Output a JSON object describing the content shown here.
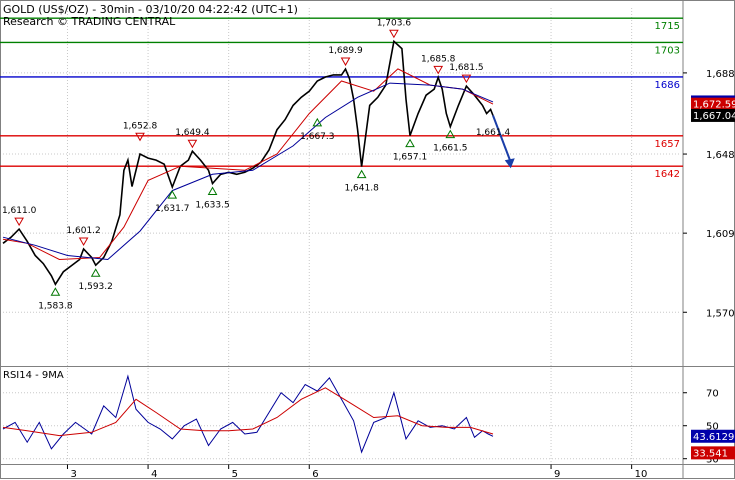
{
  "header": {
    "title": "GOLD (US$/OZ) - 30min - 03/10/20 04:22:42 (UTC+1)",
    "research": "Research © TRADING CENTRAL"
  },
  "colors": {
    "background": "#ffffff",
    "grid": "#c8c8c8",
    "price": "#000000",
    "ma_fast": "#cc0000",
    "ma_slow": "#000099",
    "resistance": "#008000",
    "pivot": "#0000cc",
    "support": "#dd0000",
    "arrow": "#1a3ea8",
    "rsi": "#000099",
    "rsi_ma": "#cc0000",
    "tag_price": "#000000",
    "tag_fast": "#cc0000",
    "tag_slow": "#0000aa"
  },
  "chart_data": [
    {
      "type": "line",
      "name": "price",
      "ylim": [
        1544,
        1720
      ],
      "y_ticks": [
        1570,
        1609,
        1648,
        1688
      ],
      "y_tick_labels": [
        "1,570",
        "1,609",
        "1,648",
        "1,688"
      ],
      "x_tick_labels": [
        "3",
        "4",
        "5",
        "6",
        "9",
        "10"
      ],
      "x_ticks": [
        3,
        4,
        5,
        6,
        9,
        10
      ],
      "xlim": [
        2.2,
        10.6
      ],
      "grid": true,
      "series": [
        {
          "values": [
            [
              2.2,
              1604
            ],
            [
              2.3,
              1607
            ],
            [
              2.4,
              1611
            ],
            [
              2.5,
              1605
            ],
            [
              2.6,
              1598
            ],
            [
              2.7,
              1594
            ],
            [
              2.8,
              1588
            ],
            [
              2.85,
              1583.8
            ],
            [
              2.95,
              1590
            ],
            [
              3.05,
              1593
            ],
            [
              3.15,
              1596
            ],
            [
              3.2,
              1601.2
            ],
            [
              3.3,
              1597
            ],
            [
              3.35,
              1593.2
            ],
            [
              3.45,
              1597
            ],
            [
              3.55,
              1605
            ],
            [
              3.65,
              1618
            ],
            [
              3.7,
              1640
            ],
            [
              3.75,
              1645
            ],
            [
              3.8,
              1632
            ],
            [
              3.9,
              1648
            ],
            [
              4.0,
              1646
            ],
            [
              4.1,
              1645
            ],
            [
              4.2,
              1643
            ],
            [
              4.3,
              1631.7
            ],
            [
              4.4,
              1642
            ],
            [
              4.5,
              1645
            ],
            [
              4.55,
              1649.4
            ],
            [
              4.65,
              1645
            ],
            [
              4.75,
              1640
            ],
            [
              4.8,
              1633.5
            ],
            [
              4.9,
              1638
            ],
            [
              5.0,
              1639
            ],
            [
              5.1,
              1638
            ],
            [
              5.2,
              1639
            ],
            [
              5.3,
              1641
            ],
            [
              5.4,
              1644
            ],
            [
              5.5,
              1650
            ],
            [
              5.6,
              1660
            ],
            [
              5.7,
              1665
            ],
            [
              5.8,
              1672
            ],
            [
              5.9,
              1676
            ],
            [
              6.0,
              1679
            ],
            [
              6.1,
              1684
            ],
            [
              6.2,
              1686
            ],
            [
              6.3,
              1687
            ],
            [
              6.4,
              1687
            ],
            [
              6.45,
              1689.9
            ],
            [
              6.5,
              1685
            ],
            [
              6.55,
              1675
            ],
            [
              6.6,
              1660
            ],
            [
              6.65,
              1641.8
            ],
            [
              6.75,
              1672
            ],
            [
              6.85,
              1676
            ],
            [
              6.95,
              1682
            ],
            [
              7.0,
              1693
            ],
            [
              7.05,
              1703.6
            ],
            [
              7.15,
              1700
            ],
            [
              7.2,
              1675
            ],
            [
              7.25,
              1657.1
            ],
            [
              7.35,
              1668
            ],
            [
              7.45,
              1677
            ],
            [
              7.55,
              1680
            ],
            [
              7.6,
              1685.8
            ],
            [
              7.65,
              1680
            ],
            [
              7.7,
              1668
            ],
            [
              7.75,
              1661.5
            ],
            [
              7.85,
              1672
            ],
            [
              7.95,
              1681.5
            ],
            [
              8.05,
              1677
            ],
            [
              8.15,
              1672
            ],
            [
              8.2,
              1668
            ],
            [
              8.25,
              1670
            ],
            [
              8.28,
              1667
            ]
          ]
        },
        {
          "values": [
            [
              2.2,
              1606
            ],
            [
              2.5,
              1604
            ],
            [
              2.9,
              1596
            ],
            [
              3.4,
              1597
            ],
            [
              3.7,
              1612
            ],
            [
              4.0,
              1635
            ],
            [
              4.4,
              1642
            ],
            [
              4.8,
              1641
            ],
            [
              5.2,
              1640
            ],
            [
              5.6,
              1648
            ],
            [
              6.0,
              1668
            ],
            [
              6.4,
              1684
            ],
            [
              6.8,
              1679
            ],
            [
              7.1,
              1690
            ],
            [
              7.5,
              1682
            ],
            [
              7.9,
              1680
            ],
            [
              8.28,
              1672.6
            ]
          ]
        },
        {
          "values": [
            [
              2.2,
              1607
            ],
            [
              2.6,
              1603
            ],
            [
              3.0,
              1598
            ],
            [
              3.5,
              1596
            ],
            [
              3.9,
              1610
            ],
            [
              4.3,
              1630
            ],
            [
              4.8,
              1638
            ],
            [
              5.3,
              1640
            ],
            [
              5.8,
              1652
            ],
            [
              6.2,
              1666
            ],
            [
              6.6,
              1676
            ],
            [
              7.0,
              1683
            ],
            [
              7.5,
              1682
            ],
            [
              7.9,
              1680
            ],
            [
              8.28,
              1673.7
            ]
          ]
        }
      ],
      "levels": [
        {
          "value": 1715,
          "label": "1715",
          "kind": "resistance"
        },
        {
          "value": 1703,
          "label": "1703",
          "kind": "resistance"
        },
        {
          "value": 1686,
          "label": "1686",
          "kind": "pivot"
        },
        {
          "value": 1657,
          "label": "1657",
          "kind": "support"
        },
        {
          "value": 1642,
          "label": "1642",
          "kind": "support"
        }
      ],
      "tags": [
        {
          "value": 1673.68,
          "label": "1,673.68",
          "kind": "slow"
        },
        {
          "value": 1672.59,
          "label": "1,672.59",
          "kind": "fast"
        },
        {
          "value": 1667.04,
          "label": "1,667.04",
          "kind": "price"
        }
      ],
      "annotations": [
        {
          "x": 2.4,
          "y": 1611.0,
          "label": "1,611.0",
          "mark": "down"
        },
        {
          "x": 2.85,
          "y": 1583.8,
          "label": "1,583.8",
          "mark": "up"
        },
        {
          "x": 3.2,
          "y": 1601.2,
          "label": "1,601.2",
          "mark": "down"
        },
        {
          "x": 3.35,
          "y": 1593.2,
          "label": "1,593.2",
          "mark": "up"
        },
        {
          "x": 3.9,
          "y": 1652.8,
          "label": "1,652.8",
          "mark": "down"
        },
        {
          "x": 4.3,
          "y": 1631.7,
          "label": "1,631.7",
          "mark": "up"
        },
        {
          "x": 4.55,
          "y": 1649.4,
          "label": "1,649.4",
          "mark": "down"
        },
        {
          "x": 4.8,
          "y": 1633.5,
          "label": "1,633.5",
          "mark": "up"
        },
        {
          "x": 6.1,
          "y": 1667.3,
          "label": "1,667.3",
          "mark": "up"
        },
        {
          "x": 6.45,
          "y": 1689.9,
          "label": "1,689.9",
          "mark": "down"
        },
        {
          "x": 6.65,
          "y": 1641.8,
          "label": "1,641.8",
          "mark": "up"
        },
        {
          "x": 7.05,
          "y": 1703.6,
          "label": "1,703.6",
          "mark": "down"
        },
        {
          "x": 7.25,
          "y": 1657.1,
          "label": "1,657.1",
          "mark": "up"
        },
        {
          "x": 7.6,
          "y": 1685.8,
          "label": "1,685.8",
          "mark": "down"
        },
        {
          "x": 7.75,
          "y": 1661.5,
          "label": "1,661.5",
          "mark": "up"
        },
        {
          "x": 7.95,
          "y": 1681.5,
          "label": "1,681.5",
          "mark": "down"
        },
        {
          "x": 8.28,
          "y": 1661.4,
          "label": "1,661.4",
          "mark": "none"
        }
      ],
      "projection": {
        "from": [
          8.28,
          1667
        ],
        "to": [
          8.5,
          1641
        ]
      }
    },
    {
      "type": "line",
      "name": "RSI14 - 9MA",
      "title": "RSI14 - 9MA",
      "ylim": [
        28,
        85
      ],
      "y_ticks": [
        30,
        50,
        70
      ],
      "y_tick_labels": [
        "30",
        "50",
        "70"
      ],
      "xlim": [
        2.2,
        10.6
      ],
      "grid": true,
      "series": [
        {
          "values": [
            [
              2.2,
              48
            ],
            [
              2.35,
              52
            ],
            [
              2.5,
              40
            ],
            [
              2.65,
              52
            ],
            [
              2.8,
              36
            ],
            [
              2.95,
              45
            ],
            [
              3.1,
              52
            ],
            [
              3.3,
              45
            ],
            [
              3.45,
              62
            ],
            [
              3.6,
              55
            ],
            [
              3.75,
              80
            ],
            [
              3.85,
              60
            ],
            [
              4.0,
              52
            ],
            [
              4.15,
              48
            ],
            [
              4.3,
              42
            ],
            [
              4.45,
              50
            ],
            [
              4.6,
              54
            ],
            [
              4.75,
              38
            ],
            [
              4.9,
              48
            ],
            [
              5.05,
              52
            ],
            [
              5.2,
              45
            ],
            [
              5.35,
              46
            ],
            [
              5.5,
              58
            ],
            [
              5.65,
              70
            ],
            [
              5.8,
              64
            ],
            [
              5.95,
              75
            ],
            [
              6.1,
              71
            ],
            [
              6.25,
              79
            ],
            [
              6.4,
              66
            ],
            [
              6.55,
              53
            ],
            [
              6.65,
              34
            ],
            [
              6.8,
              52
            ],
            [
              6.95,
              55
            ],
            [
              7.05,
              70
            ],
            [
              7.2,
              42
            ],
            [
              7.35,
              53
            ],
            [
              7.5,
              49
            ],
            [
              7.65,
              50
            ],
            [
              7.8,
              48
            ],
            [
              7.95,
              55
            ],
            [
              8.05,
              43
            ],
            [
              8.15,
              47
            ],
            [
              8.22,
              45
            ],
            [
              8.28,
              43.6
            ]
          ]
        },
        {
          "values": [
            [
              2.2,
              49
            ],
            [
              2.5,
              47
            ],
            [
              2.9,
              44
            ],
            [
              3.3,
              46
            ],
            [
              3.6,
              52
            ],
            [
              3.85,
              66
            ],
            [
              4.1,
              58
            ],
            [
              4.4,
              48
            ],
            [
              4.7,
              47
            ],
            [
              5.0,
              47
            ],
            [
              5.3,
              48
            ],
            [
              5.6,
              55
            ],
            [
              5.9,
              66
            ],
            [
              6.2,
              73
            ],
            [
              6.5,
              64
            ],
            [
              6.8,
              55
            ],
            [
              7.1,
              56
            ],
            [
              7.4,
              50
            ],
            [
              7.7,
              49
            ],
            [
              8.0,
              49
            ],
            [
              8.28,
              45
            ]
          ]
        }
      ],
      "tags": [
        {
          "value": 43.6129,
          "label": "43.6129",
          "kind": "slow"
        },
        {
          "value": 33.541,
          "label": "33.541",
          "kind": "fast"
        }
      ]
    }
  ]
}
